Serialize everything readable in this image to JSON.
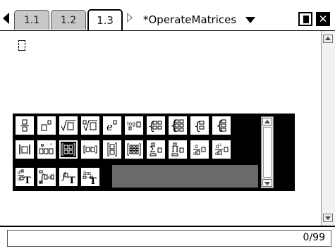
{
  "tabs": [
    {
      "label": "1.1",
      "active": false
    },
    {
      "label": "1.2",
      "active": false
    },
    {
      "label": "1.3",
      "active": true
    }
  ],
  "document_title": "*OperateMatrices",
  "status": {
    "char_counter": "0/99"
  },
  "palette": {
    "rows": [
      [
        "fraction-template",
        "exponent-template",
        "square-root-template",
        "nth-root-template",
        "e-exponent-template",
        "log-template",
        "piecewise-2-template",
        "piecewise-n-template",
        "system-2-template",
        "system-n-template"
      ],
      [
        "absolute-value-template",
        "degree-minute-second-template",
        "matrix-2x2-template",
        "row-matrix-template",
        "column-matrix-template",
        "matrix-mxn-template",
        "sum-template",
        "product-template",
        "derivative-template",
        "second-derivative-template"
      ],
      [
        "nth-derivative-template",
        "definite-integral-template",
        "indefinite-integral-template",
        "limit-template"
      ]
    ],
    "selected": "matrix-2x2-template"
  }
}
